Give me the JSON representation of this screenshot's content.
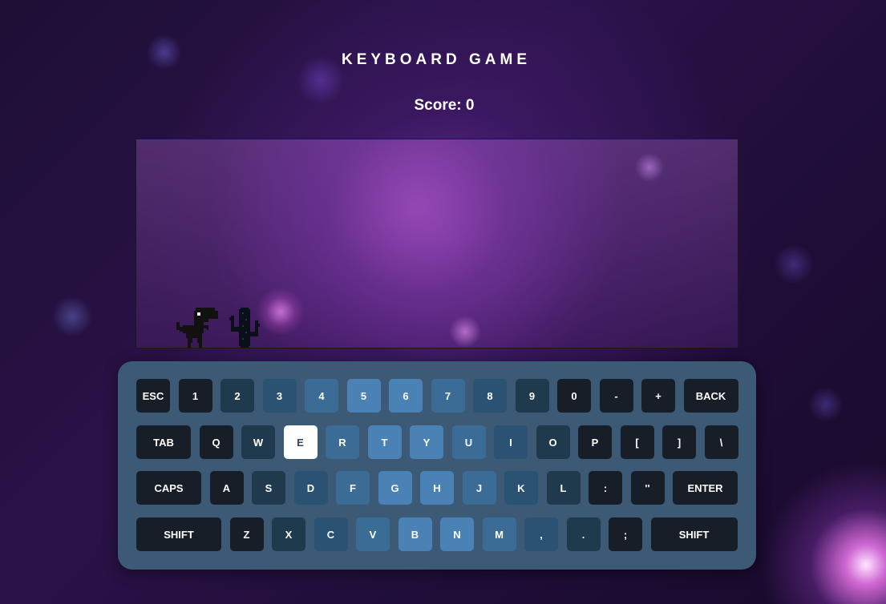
{
  "title": "KEYBOARD GAME",
  "score_text": "Score: 0",
  "game": {
    "player_icon": "dinosaur",
    "obstacle_icon": "cactus"
  },
  "active_key": "E",
  "keyboard": {
    "rows": [
      [
        {
          "label": "ESC",
          "shade": 0
        },
        {
          "label": "1",
          "shade": 0
        },
        {
          "label": "2",
          "shade": 1
        },
        {
          "label": "3",
          "shade": 2
        },
        {
          "label": "4",
          "shade": 3
        },
        {
          "label": "5",
          "shade": 4
        },
        {
          "label": "6",
          "shade": 4
        },
        {
          "label": "7",
          "shade": 3
        },
        {
          "label": "8",
          "shade": 2
        },
        {
          "label": "9",
          "shade": 1
        },
        {
          "label": "0",
          "shade": 0
        },
        {
          "label": "-",
          "shade": 0
        },
        {
          "label": "+",
          "shade": 0
        },
        {
          "label": "BACK",
          "shade": 0
        }
      ],
      [
        {
          "label": "TAB",
          "shade": 0
        },
        {
          "label": "Q",
          "shade": 0
        },
        {
          "label": "W",
          "shade": 1
        },
        {
          "label": "E",
          "shade": 2
        },
        {
          "label": "R",
          "shade": 3
        },
        {
          "label": "T",
          "shade": 4
        },
        {
          "label": "Y",
          "shade": 4
        },
        {
          "label": "U",
          "shade": 3
        },
        {
          "label": "I",
          "shade": 2
        },
        {
          "label": "O",
          "shade": 1
        },
        {
          "label": "P",
          "shade": 0
        },
        {
          "label": "[",
          "shade": 0
        },
        {
          "label": "]",
          "shade": 0
        },
        {
          "label": "\\",
          "shade": 0
        }
      ],
      [
        {
          "label": "CAPS",
          "shade": 0
        },
        {
          "label": "A",
          "shade": 0
        },
        {
          "label": "S",
          "shade": 1
        },
        {
          "label": "D",
          "shade": 2
        },
        {
          "label": "F",
          "shade": 3
        },
        {
          "label": "G",
          "shade": 4
        },
        {
          "label": "H",
          "shade": 4
        },
        {
          "label": "J",
          "shade": 3
        },
        {
          "label": "K",
          "shade": 2
        },
        {
          "label": "L",
          "shade": 1
        },
        {
          "label": ":",
          "shade": 0
        },
        {
          "label": "''",
          "shade": 0
        },
        {
          "label": "ENTER",
          "shade": 0
        }
      ],
      [
        {
          "label": "SHIFT",
          "shade": 0
        },
        {
          "label": "Z",
          "shade": 0
        },
        {
          "label": "X",
          "shade": 1
        },
        {
          "label": "C",
          "shade": 2
        },
        {
          "label": "V",
          "shade": 3
        },
        {
          "label": "B",
          "shade": 4
        },
        {
          "label": "N",
          "shade": 4
        },
        {
          "label": "M",
          "shade": 3
        },
        {
          "label": ",",
          "shade": 2
        },
        {
          "label": ".",
          "shade": 1
        },
        {
          "label": ";",
          "shade": 0
        },
        {
          "label": "SHIFT",
          "shade": 0
        }
      ]
    ]
  }
}
